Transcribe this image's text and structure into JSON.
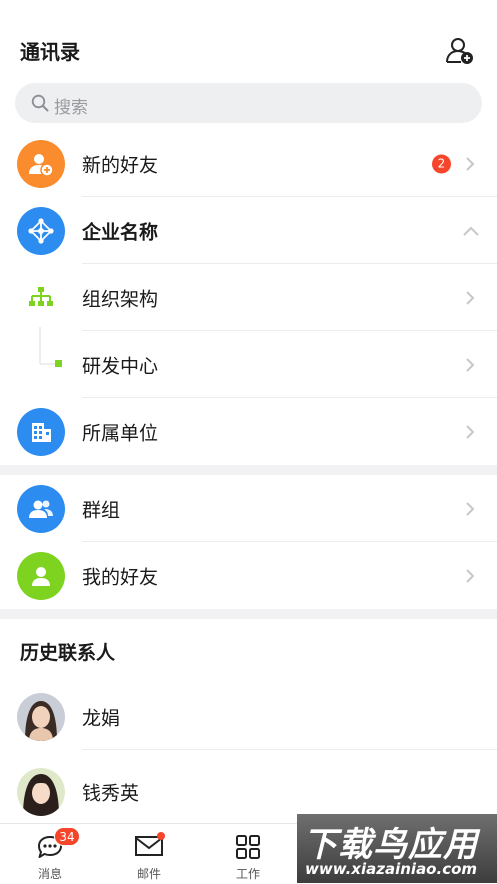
{
  "header": {
    "title": "通讯录"
  },
  "search": {
    "placeholder": "搜索"
  },
  "new_friends": {
    "label": "新的好友",
    "badge": "2"
  },
  "company": {
    "label": "企业名称"
  },
  "org_structure": {
    "label": "组织架构"
  },
  "rnd_center": {
    "label": "研发中心"
  },
  "affiliated_units": {
    "label": "所属单位"
  },
  "groups": {
    "label": "群组"
  },
  "my_friends": {
    "label": "我的好友"
  },
  "history": {
    "title": "历史联系人",
    "contacts": [
      {
        "name": "龙娟"
      },
      {
        "name": "钱秀英"
      }
    ]
  },
  "tabbar": {
    "tabs": [
      {
        "label": "消息",
        "icon": "chat-icon",
        "badge": "34"
      },
      {
        "label": "邮件",
        "icon": "mail-icon"
      },
      {
        "label": "工作",
        "icon": "grid-icon"
      }
    ]
  },
  "watermark": {
    "main": "下载鸟应用",
    "sub": "www.xiazainiao.com"
  },
  "colors": {
    "orange": "#fa8c2e",
    "blue": "#2d8cf0",
    "green": "#7ed321",
    "red": "#f5452b",
    "chevron": "#c7c7cc"
  }
}
